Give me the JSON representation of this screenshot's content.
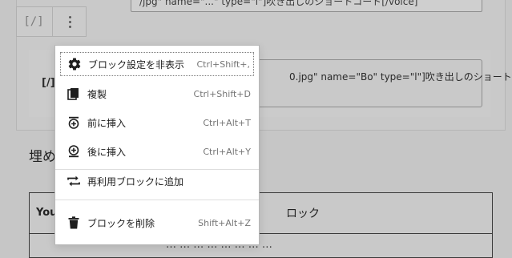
{
  "background": {
    "top_block_text": "/jpg\" name=\"...\" type=\"l\"]吹き出しのショートコード[/voice]",
    "toolbar_shortcode_label": "[/]",
    "inner_label": "[/]",
    "shortcode_text": "0.jpg\" name=\"Bo\" type=\"l\"]吹き出しのショート",
    "heading": "埋め",
    "table_header_left": "You",
    "table_header_right": "ロック",
    "table_fragment": "… … … … … … … …"
  },
  "menu": {
    "items": [
      {
        "icon": "gear-icon",
        "label": "ブロック設定を非表示",
        "shortcut": "Ctrl+Shift+,"
      },
      {
        "icon": "duplicate-icon",
        "label": "複製",
        "shortcut": "Ctrl+Shift+D"
      },
      {
        "icon": "insert-before-icon",
        "label": "前に挿入",
        "shortcut": "Ctrl+Alt+T"
      },
      {
        "icon": "insert-after-icon",
        "label": "後に挿入",
        "shortcut": "Ctrl+Alt+Y"
      },
      {
        "icon": "reusable-block-icon",
        "label": "再利用ブロックに追加",
        "shortcut": ""
      },
      {
        "icon": "trash-icon",
        "label": "ブロックを削除",
        "shortcut": "Shift+Alt+Z"
      }
    ]
  }
}
